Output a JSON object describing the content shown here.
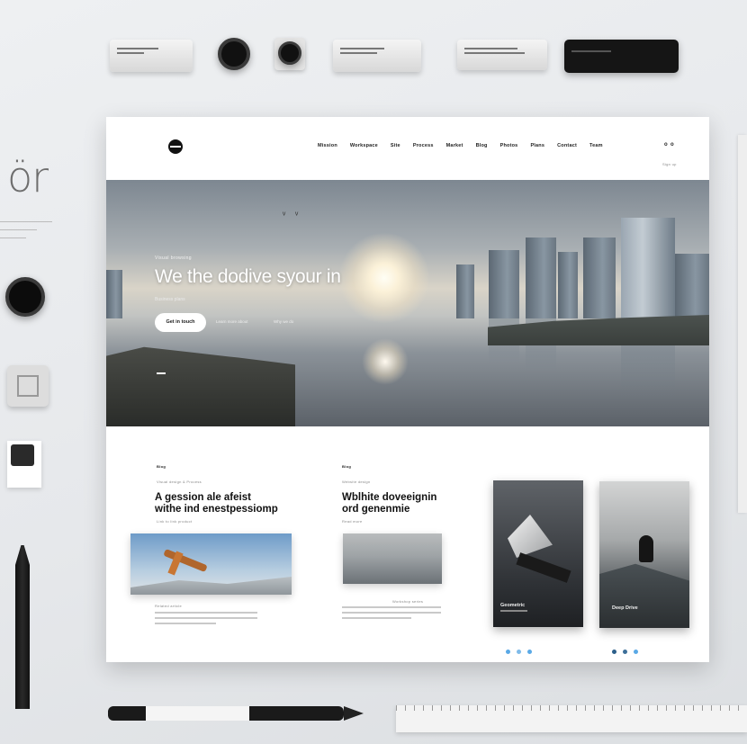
{
  "props": {
    "logo_glyph": "ör"
  },
  "site": {
    "nav": [
      "Mission",
      "Workspace",
      "Site",
      "Process",
      "Market",
      "Blog",
      "Photos",
      "Plans",
      "Contact",
      "Team"
    ],
    "nav_sub": "Sign up",
    "hero": {
      "eyebrow": "Visual browsing",
      "headline": "We the dodive syour in",
      "sub": "Business plans",
      "cta": "Get in touch",
      "link1": "Learn more about",
      "link2": "Why we do"
    },
    "cards": [
      {
        "tag": "Blog",
        "eyebrow": "Visual design & Process",
        "title_1": "A gession ale afeist",
        "title_2": "withe ind enestpessiomp",
        "meta": "Link to link product",
        "caption": "Related article"
      },
      {
        "tag": "Blog",
        "eyebrow": "Website design",
        "title_1": "Wblhite doveeignin",
        "title_2": "ord genenmie",
        "meta": "Read more",
        "caption": "Workshop series"
      }
    ],
    "tiles": [
      {
        "caption": "Geometric"
      },
      {
        "caption": "Deep Drive"
      }
    ],
    "colors": {
      "accent": "#5aa9e6"
    }
  }
}
